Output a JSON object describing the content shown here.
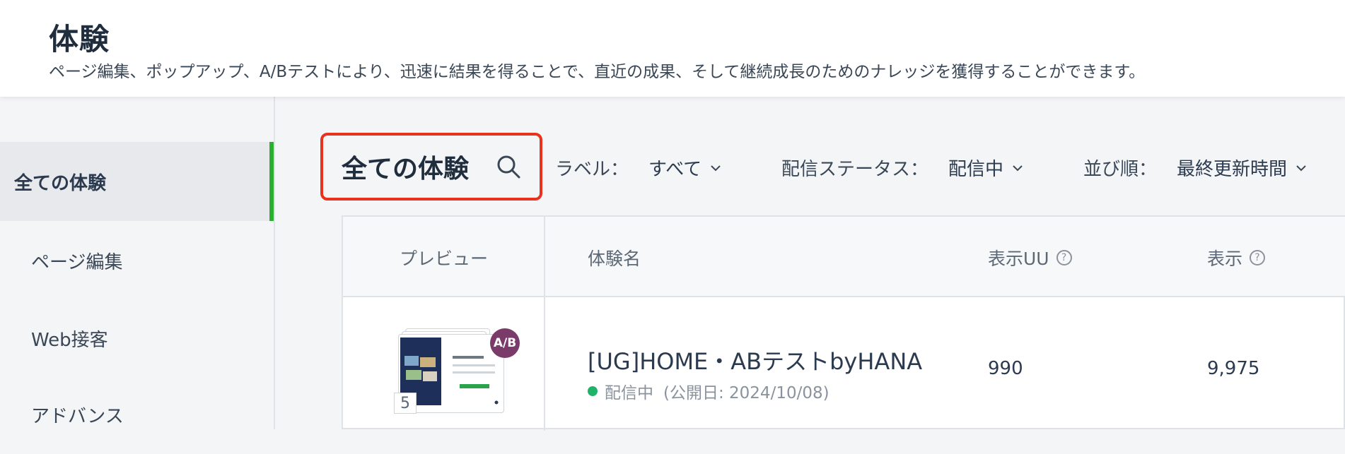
{
  "header": {
    "title": "体験",
    "description": "ページ編集、ポップアップ、A/Bテストにより、迅速に結果を得ることで、直近の成果、そして継続成長のためのナレッジを獲得することができます。"
  },
  "sidebar": {
    "items": [
      {
        "label": "全ての体験",
        "active": true
      },
      {
        "label": "ページ編集"
      },
      {
        "label": "Web接客"
      },
      {
        "label": "アドバンス"
      }
    ]
  },
  "toolbar": {
    "search_title": "全ての体験",
    "filters": [
      {
        "label": "ラベル：",
        "value": "すべて"
      },
      {
        "label": "配信ステータス：",
        "value": "配信中"
      },
      {
        "label": "並び順：",
        "value": "最終更新時間"
      }
    ]
  },
  "table": {
    "columns": [
      {
        "label": "プレビュー"
      },
      {
        "label": "体験名"
      },
      {
        "label": "表示UU",
        "help": "?"
      },
      {
        "label": "表示",
        "help": "?"
      }
    ],
    "rows": [
      {
        "badge": "A/B",
        "variant_count": "5",
        "name": "[UG]HOME・ABテストbyHANA",
        "status": "配信中",
        "published": "(公開日: 2024/10/08)",
        "uu": "990",
        "views": "9,975"
      }
    ]
  },
  "colors": {
    "accent_green": "#29b02f",
    "highlight_red": "#e8321e",
    "status_green": "#1fb36a",
    "ab_badge": "#7a3a6a"
  },
  "icons": [
    "search-icon",
    "chevron-down-icon",
    "help-icon",
    "status-dot"
  ]
}
